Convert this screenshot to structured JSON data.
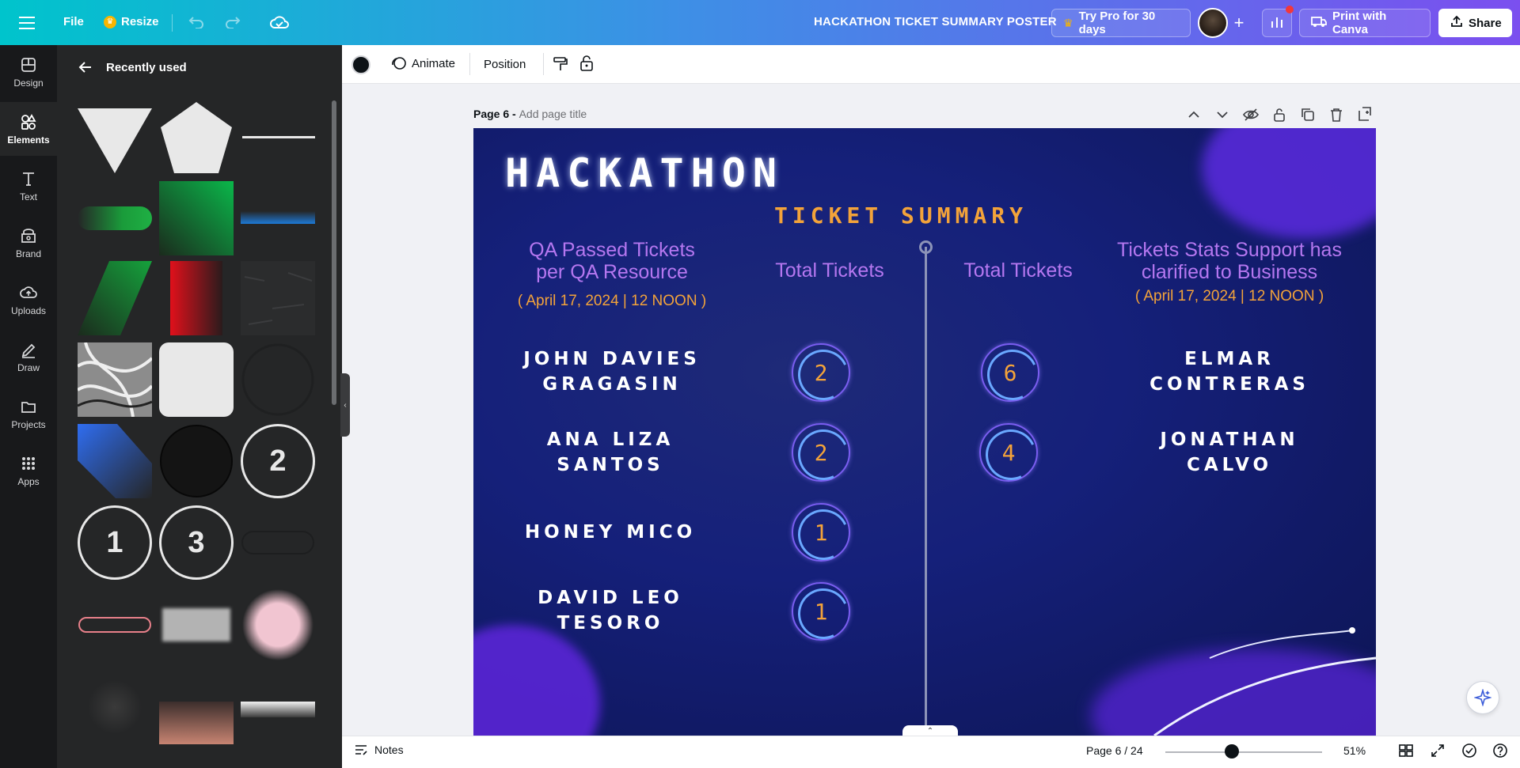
{
  "topbar": {
    "file_label": "File",
    "resize_label": "Resize",
    "doc_title": "HACKATHON TICKET SUMMARY POSTER",
    "try_pro_label": "Try Pro for 30 days",
    "print_label": "Print with Canva",
    "share_label": "Share"
  },
  "rail": {
    "items": [
      {
        "label": "Design",
        "icon": "design-icon"
      },
      {
        "label": "Elements",
        "icon": "elements-icon"
      },
      {
        "label": "Text",
        "icon": "text-icon"
      },
      {
        "label": "Brand",
        "icon": "brand-icon"
      },
      {
        "label": "Uploads",
        "icon": "uploads-icon"
      },
      {
        "label": "Draw",
        "icon": "draw-icon"
      },
      {
        "label": "Projects",
        "icon": "projects-icon"
      },
      {
        "label": "Apps",
        "icon": "apps-icon"
      }
    ],
    "active": "Elements"
  },
  "panel": {
    "title": "Recently used",
    "number_tiles": [
      "2",
      "1",
      "3"
    ]
  },
  "subbar": {
    "animate_label": "Animate",
    "position_label": "Position"
  },
  "canvas": {
    "page_label": "Page 6 - ",
    "page_title_placeholder": "Add page title"
  },
  "poster": {
    "title": "HACKATHON",
    "subtitle": "TICKET SUMMARY",
    "left_heading_line1": "QA Passed Tickets",
    "left_heading_line2": "per QA Resource",
    "left_date": "( April 17, 2024 | 12 NOON )",
    "col_total_left": "Total Tickets",
    "col_total_right": "Total Tickets",
    "right_heading_line1": "Tickets Stats Support has",
    "right_heading_line2": "clarified to Business",
    "right_date": "( April 17, 2024 | 12 NOON )",
    "qa_rows": [
      {
        "name_line1": "JOHN DAVIES",
        "name_line2": "GRAGASIN",
        "total": "2"
      },
      {
        "name_line1": "ANA LIZA",
        "name_line2": "SANTOS",
        "total": "2"
      },
      {
        "name_line1": "HONEY MICO",
        "name_line2": "",
        "total": "1"
      },
      {
        "name_line1": "DAVID LEO",
        "name_line2": "TESORO",
        "total": "1"
      }
    ],
    "support_rows": [
      {
        "name_line1": "ELMAR",
        "name_line2": "CONTRERAS",
        "total": "6"
      },
      {
        "name_line1": "JONATHAN",
        "name_line2": "CALVO",
        "total": "4"
      }
    ]
  },
  "bottombar": {
    "notes_label": "Notes",
    "page_indicator": "Page 6 / 24",
    "zoom": "51%"
  },
  "colors": {
    "accent_cyan": "#00c4cc",
    "accent_purple": "#7b4fef",
    "poster_orange": "#f3a33a",
    "poster_lilac": "#b577f0"
  }
}
